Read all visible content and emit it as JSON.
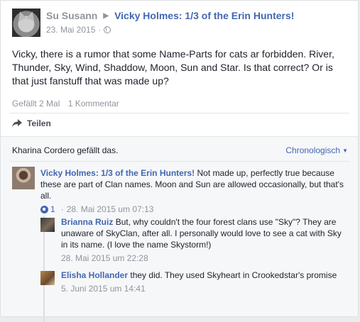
{
  "post": {
    "author": "Su Susann",
    "target": "Vicky Holmes: 1/3 of the Erin Hunters!",
    "date": "23. Mai 2015",
    "text": "Vicky, there is a rumor that some Name-Parts for cats ar forbidden. River, Thunder, Sky, Wind, Shaddow, Moon, Sun and Star. Is that correct? Or is that just fanstuff that was made up?",
    "likes_label": "Gefällt 2 Mal",
    "comments_label": "1 Kommentar",
    "share_label": "Teilen"
  },
  "comments_area": {
    "likes_line": "Kharina Cordero gefällt das.",
    "order_label": "Chronologisch"
  },
  "comments": [
    {
      "author": "Vicky Holmes: 1/3 of the Erin Hunters!",
      "text": "Not made up, perfectly true because these are part of Clan names. Moon and Sun are allowed occasionally, but that's all.",
      "like_count": "1",
      "time": "28. Mai 2015 um 07:13"
    }
  ],
  "replies": [
    {
      "author": "Brianna Ruiz",
      "text": "But, why couldn't the four forest clans use \"Sky\"? They are unaware of SkyClan, after all. I personally would love to see a cat with Sky in its name. (I love the name Skystorm!)",
      "time": "28. Mai 2015 um 22:28"
    },
    {
      "author": "Elisha Hollander",
      "text": "they did. They used Skyheart in Crookedstar's promise",
      "time": "5. Juni 2015 um 14:41"
    }
  ],
  "colors": {
    "link": "#4267b2",
    "meta": "#90949c",
    "background": "#f6f7f9"
  },
  "icons": [
    "cat-avatar",
    "triangle-right-icon",
    "globe-icon",
    "share-icon",
    "caret-down-icon",
    "like-icon"
  ]
}
